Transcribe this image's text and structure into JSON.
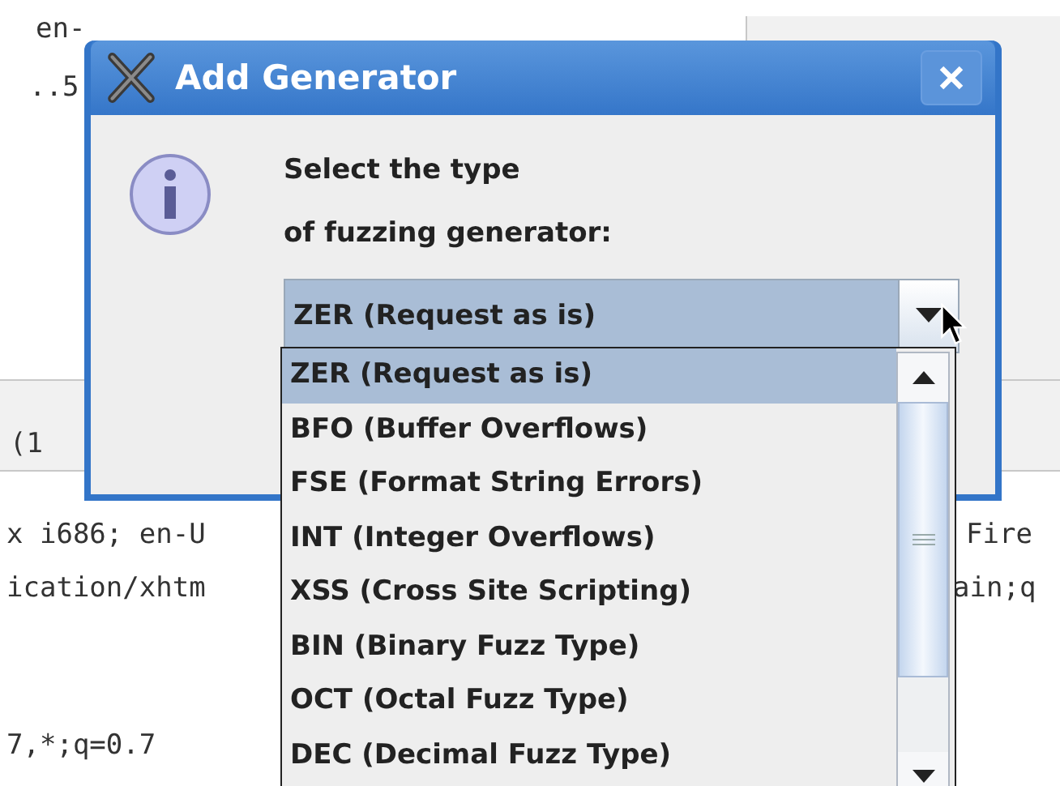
{
  "background": {
    "fragments": [
      {
        "text": "en-"
      },
      {
        "text": "..5"
      },
      {
        "text": "(1"
      },
      {
        "text": "x i686; en-U"
      },
      {
        "text": "ication/xhtm"
      },
      {
        "text": "7,*;q=0.7"
      },
      {
        "text": "Fire"
      },
      {
        "text": "ain;q"
      }
    ]
  },
  "dialog": {
    "title": "Add Generator",
    "message": [
      "Select the type",
      "of fuzzing generator:"
    ],
    "combo": {
      "value": "ZER (Request as is)",
      "expanded": true
    },
    "options": [
      {
        "label": "ZER (Request as is)",
        "selected": true
      },
      {
        "label": "BFO (Buffer Overflows)",
        "selected": false
      },
      {
        "label": "FSE (Format String Errors)",
        "selected": false
      },
      {
        "label": "INT (Integer Overflows)",
        "selected": false
      },
      {
        "label": "XSS (Cross Site Scripting)",
        "selected": false
      },
      {
        "label": "BIN (Binary Fuzz Type)",
        "selected": false
      },
      {
        "label": "OCT (Octal Fuzz Type)",
        "selected": false
      },
      {
        "label": "DEC (Decimal Fuzz Type)",
        "selected": false
      }
    ]
  }
}
